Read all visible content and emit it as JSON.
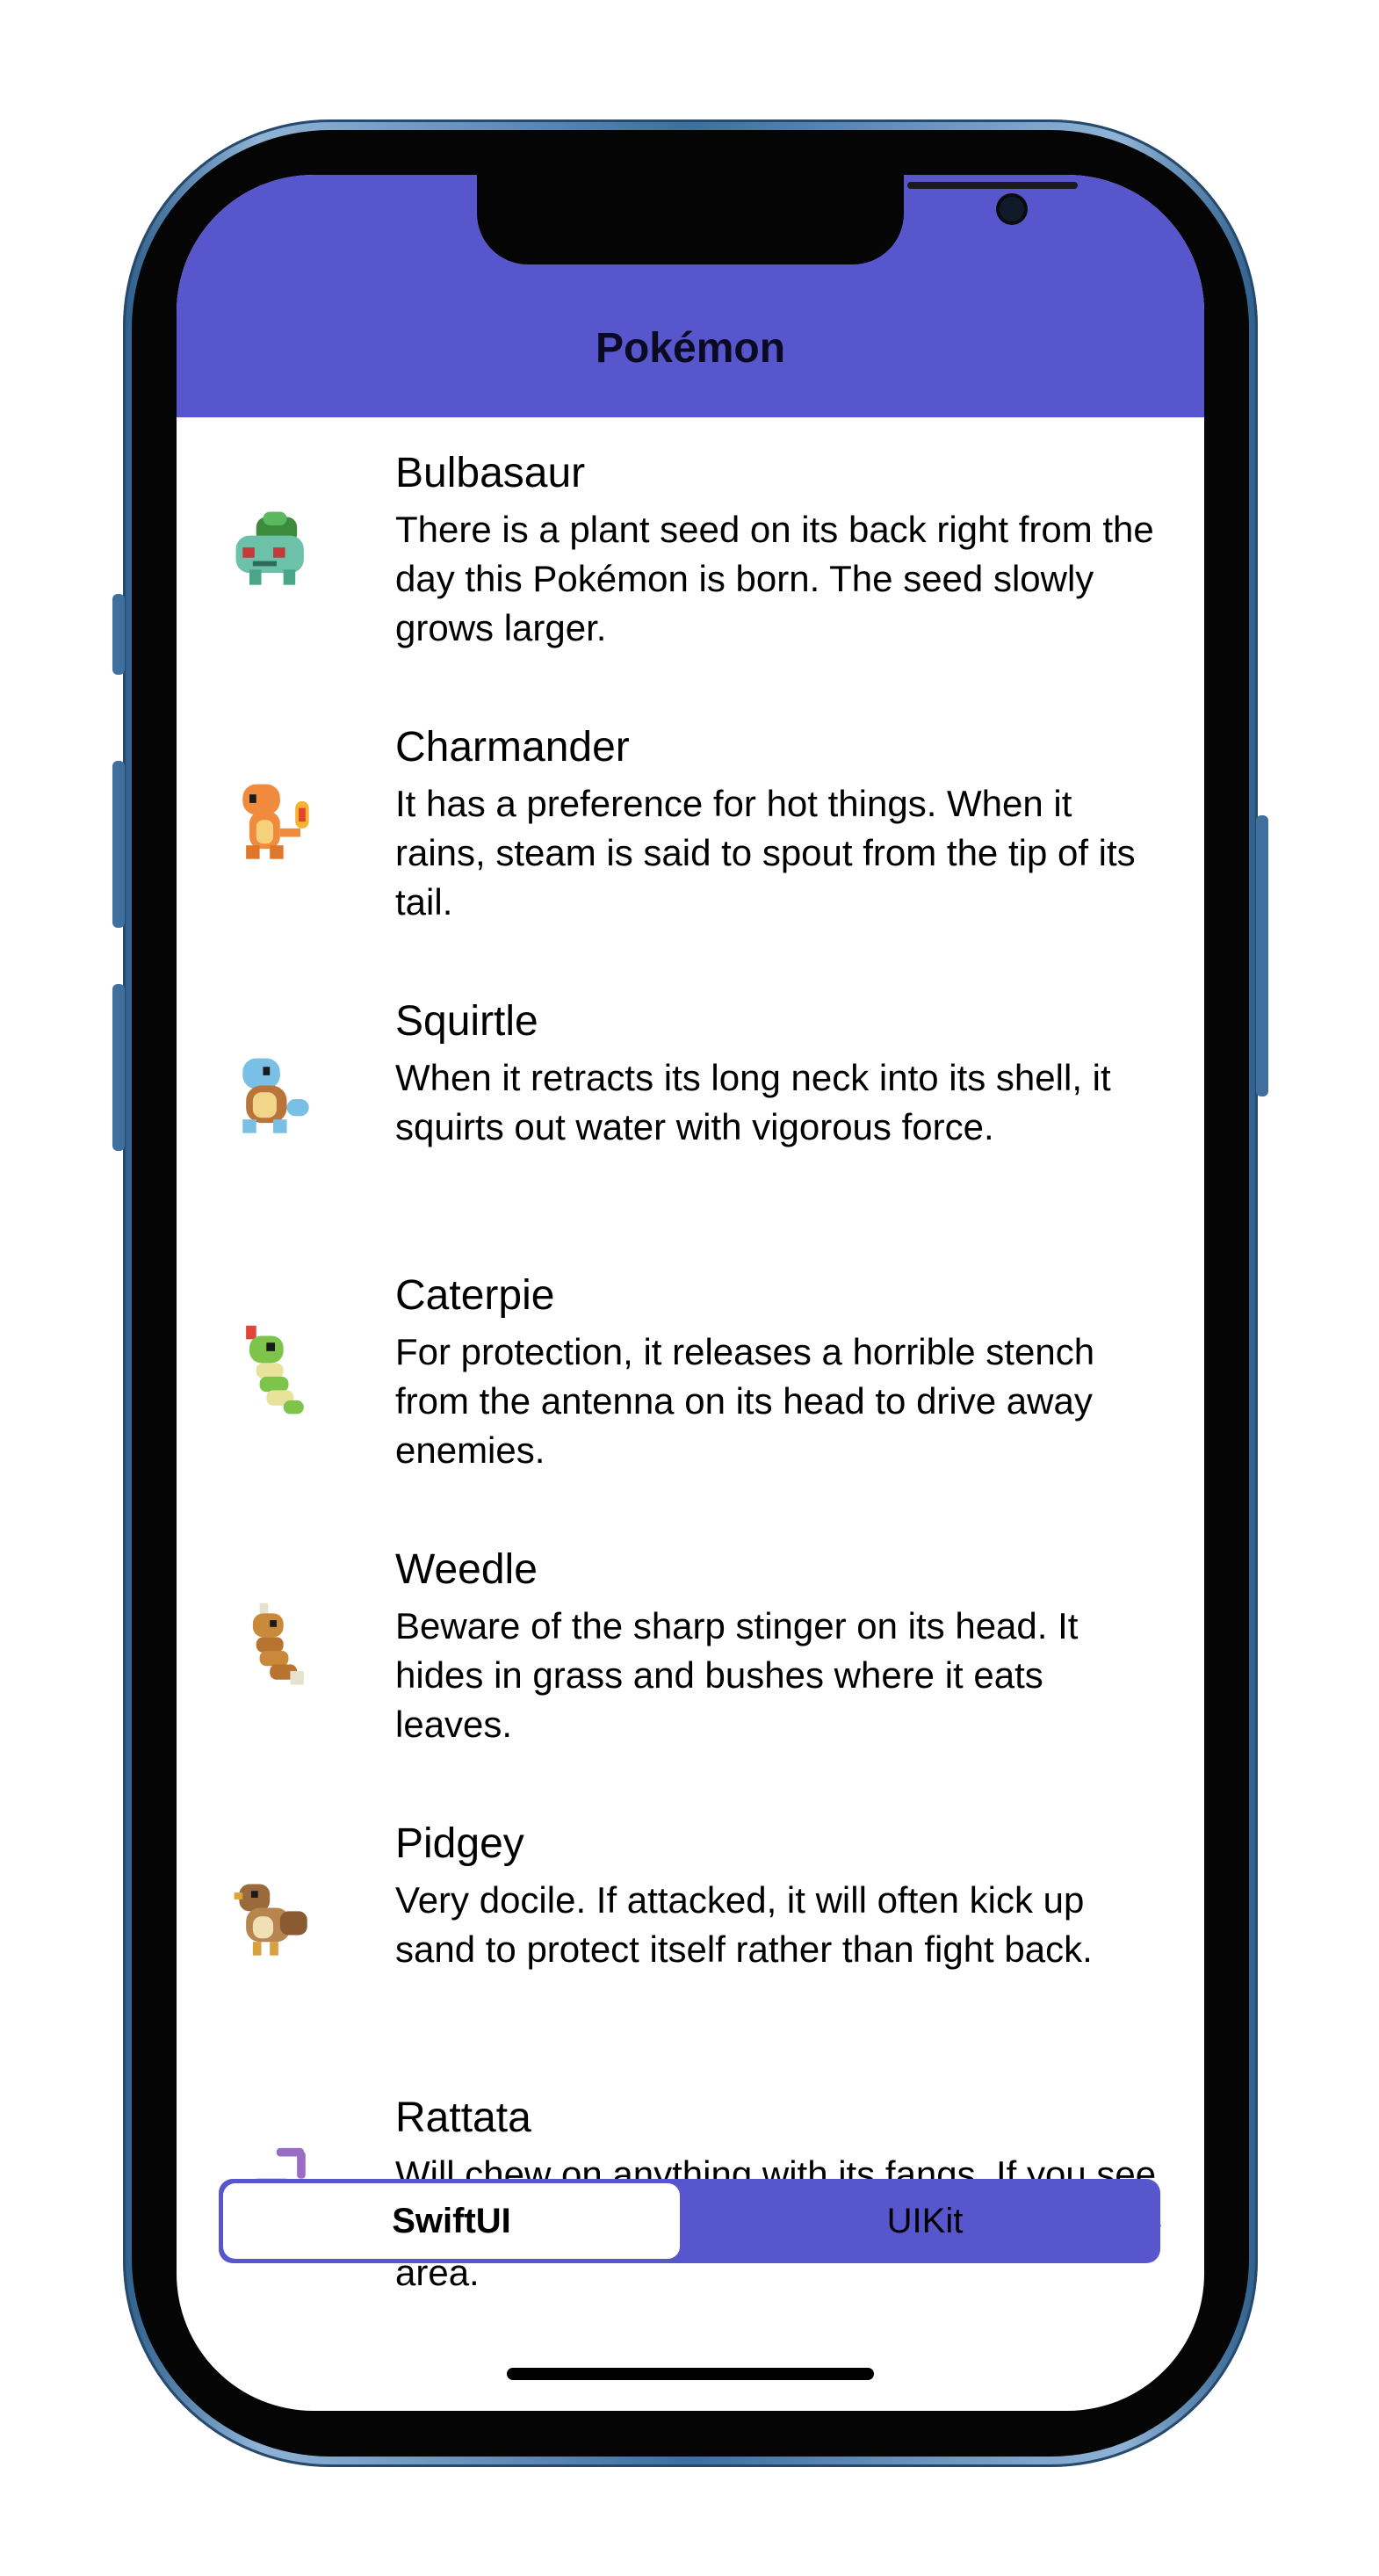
{
  "navbar": {
    "title": "Pokémon",
    "color": "#5856CC"
  },
  "pokemon": [
    {
      "name": "Bulbasaur",
      "description": "There is a plant seed on its back right from the day this Pokémon is born. The seed slowly grows larger.",
      "icon": "bulbasaur-sprite"
    },
    {
      "name": "Charmander",
      "description": "It has a preference for hot things. When it rains, steam is said to spout from the tip of its tail.",
      "icon": "charmander-sprite"
    },
    {
      "name": "Squirtle",
      "description": "When it retracts its long neck into its shell, it squirts out water with vigorous force.",
      "icon": "squirtle-sprite"
    },
    {
      "name": "Caterpie",
      "description": "For protection, it releases a horrible stench from the antenna on its head to drive away enemies.",
      "icon": "caterpie-sprite"
    },
    {
      "name": "Weedle",
      "description": "Beware of the sharp stinger on its head. It hides in grass and bushes where it eats leaves.",
      "icon": "weedle-sprite"
    },
    {
      "name": "Pidgey",
      "description": "Very docile. If attacked, it will often kick up sand to protect itself rather than fight back.",
      "icon": "pidgey-sprite"
    },
    {
      "name": "Rattata",
      "description": "Will chew on anything with its fangs. If you see one, you can be certain that 40 more live in the area.",
      "icon": "rattata-sprite"
    }
  ],
  "segmented_control": {
    "options": [
      "SwiftUI",
      "UIKit"
    ],
    "selected": "SwiftUI"
  }
}
